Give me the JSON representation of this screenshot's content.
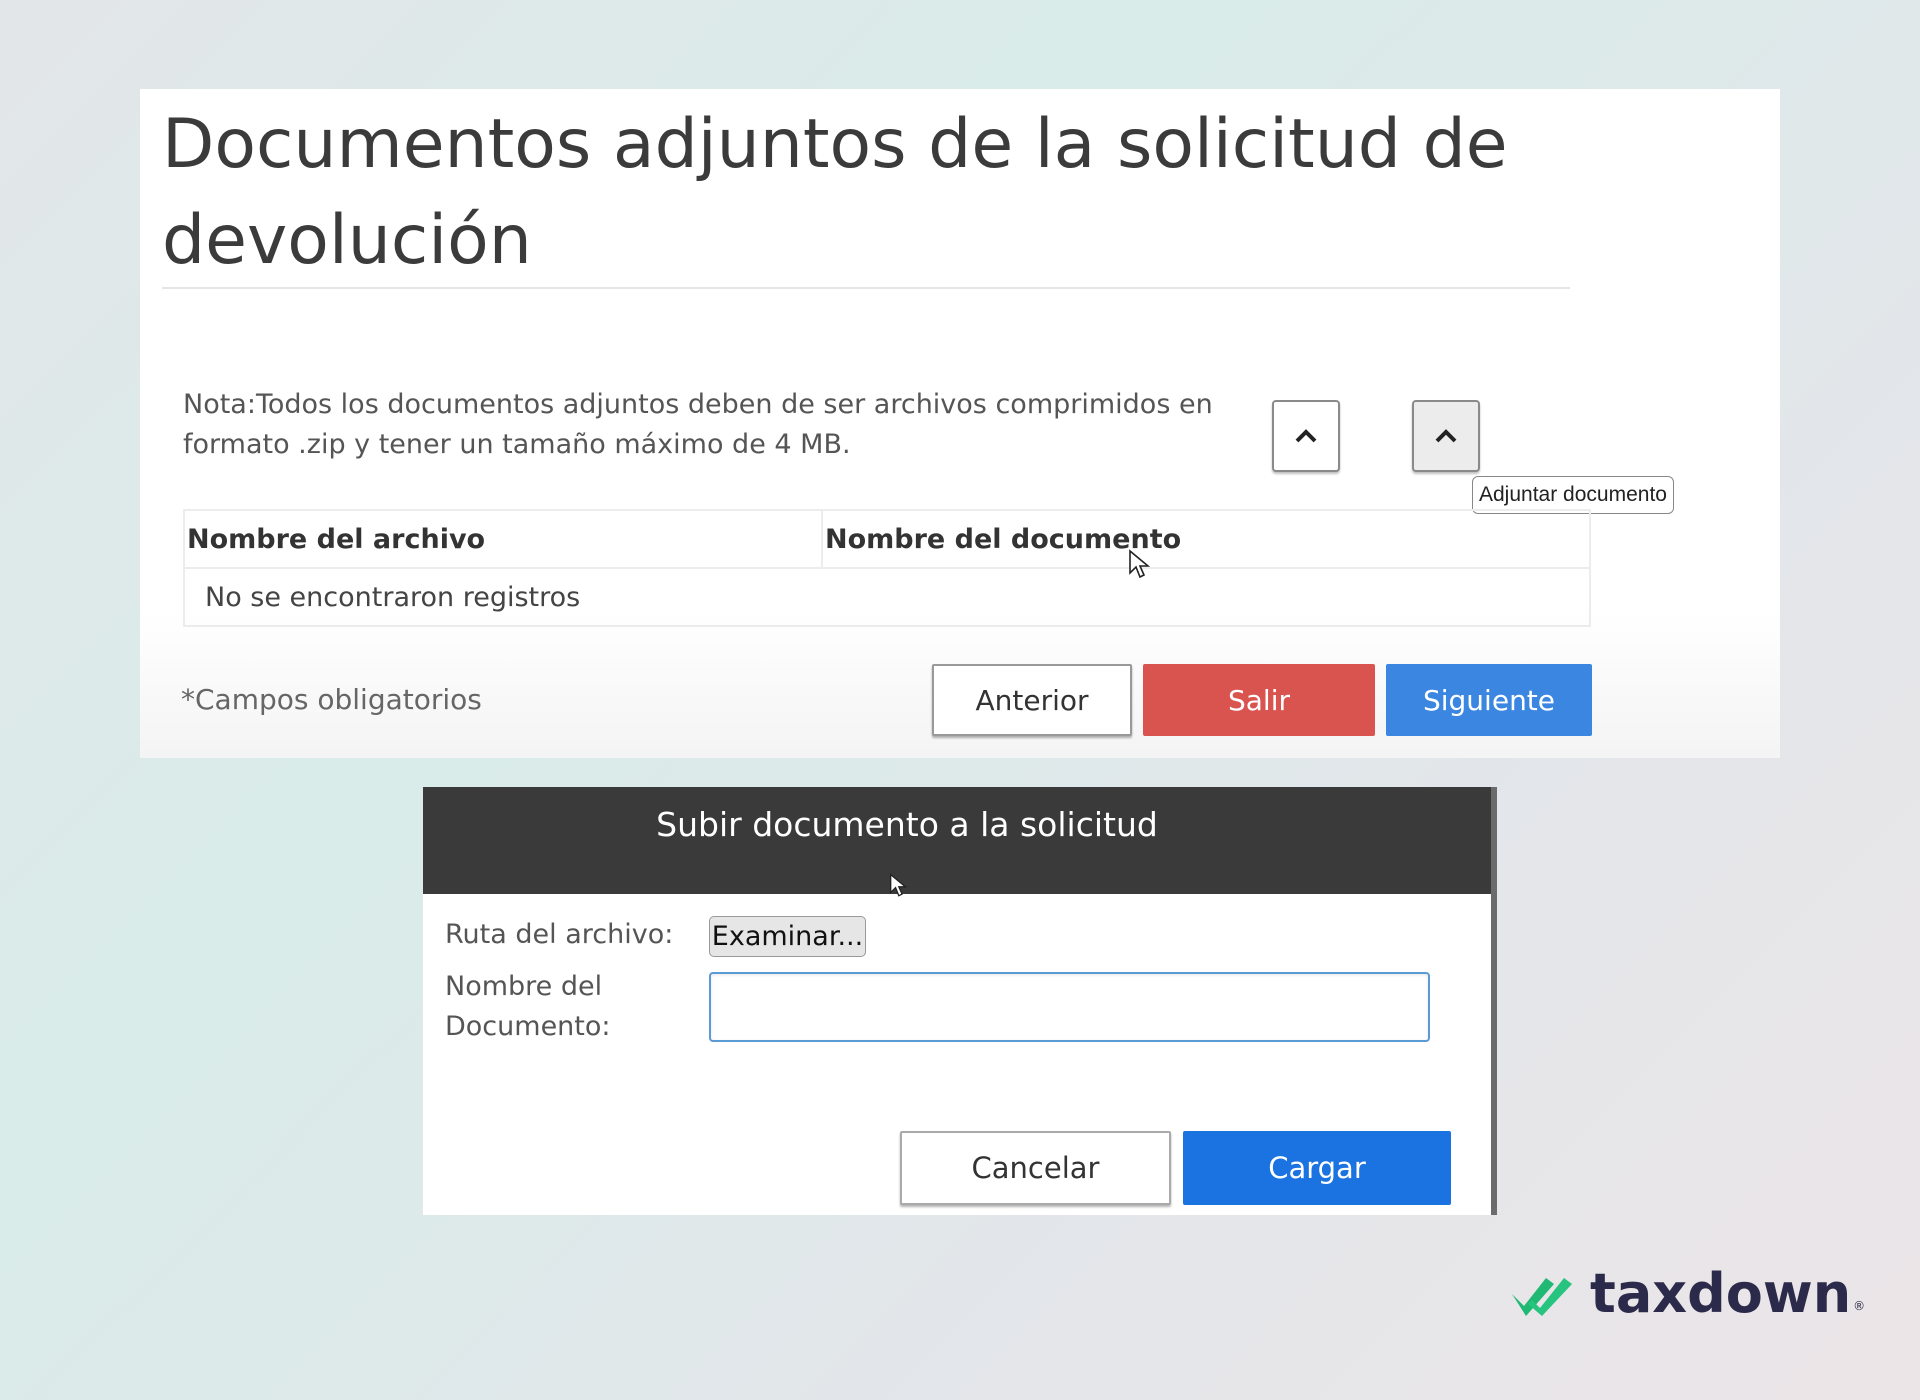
{
  "page": {
    "title": "Documentos adjuntos de la solicitud de devolución",
    "note": "Nota:Todos los documentos adjuntos deben de ser archivos comprimidos en formato .zip y tener un tamaño máximo de 4 MB.",
    "attach_tooltip": "Adjuntar documento",
    "required_fields": "*Campos obligatorios"
  },
  "table": {
    "columns": [
      "Nombre del archivo",
      "Nombre del documento"
    ],
    "empty_message": "No se encontraron registros"
  },
  "buttons": {
    "previous": "Anterior",
    "exit": "Salir",
    "next": "Siguiente"
  },
  "dialog": {
    "title": "Subir documento a la solicitud",
    "file_path_label": "Ruta del archivo:",
    "browse": "Examinar...",
    "doc_name_label": "Nombre del Documento:",
    "doc_name_value": "",
    "cancel": "Cancelar",
    "upload": "Cargar"
  },
  "brand": {
    "name": "taxdown",
    "registered": "®"
  },
  "colors": {
    "exit": "#d9534f",
    "next": "#3a86e0",
    "upload": "#1a73e0",
    "dialog_header": "#3a3a3a",
    "brand_check": "#1fb974",
    "brand_text": "#2c2a4a"
  }
}
